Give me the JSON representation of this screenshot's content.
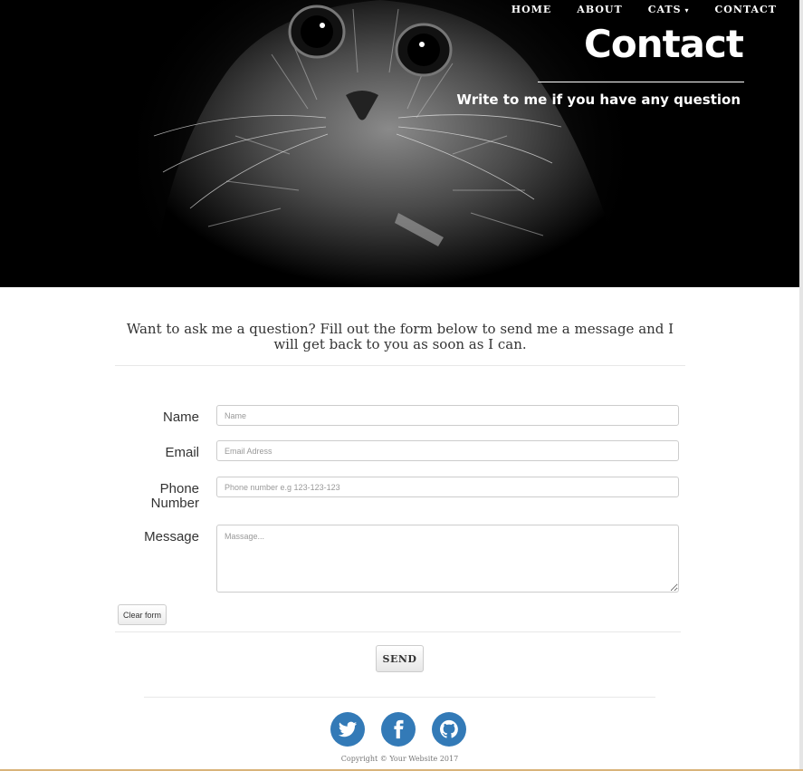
{
  "nav": {
    "items": [
      {
        "label": "HOME"
      },
      {
        "label": "ABOUT"
      },
      {
        "label": "CATS"
      },
      {
        "label": "CONTACT"
      }
    ]
  },
  "hero": {
    "title": "Contact",
    "subtitle": "Write to me if you have any question"
  },
  "intro": "Want to ask me a question? Fill out the form below to send me a message and I will get back to you as soon as I can.",
  "form": {
    "name_label": "Name",
    "name_placeholder": "Name",
    "email_label": "Email",
    "email_placeholder": "Email Adress",
    "phone_label_1": "Phone",
    "phone_label_2": "Number",
    "phone_placeholder": "Phone number e.g 123-123-123",
    "message_label": "Message",
    "message_placeholder": "Massage...",
    "clear_label": "Clear form",
    "send_label": "SEND"
  },
  "social": [
    {
      "icon": "twitter-icon"
    },
    {
      "icon": "facebook-icon"
    },
    {
      "icon": "github-icon"
    }
  ],
  "footer": {
    "copyright": "Copyright © Your Website 2017"
  },
  "colors": {
    "hero_bg": "#000000",
    "social_bg": "#337ab7",
    "bottom_line": "#d9b37a"
  }
}
